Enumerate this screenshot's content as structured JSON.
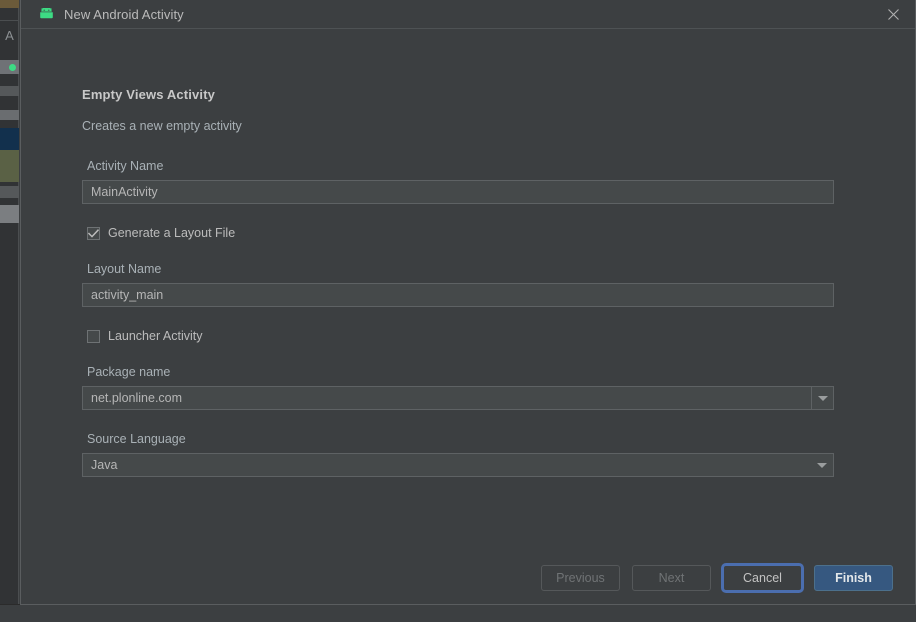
{
  "window": {
    "title": "New Android Activity",
    "app_icon": "android-robot-icon",
    "close_icon": "close-icon"
  },
  "content": {
    "template_title": "Empty Views Activity",
    "template_description": "Creates a new empty activity",
    "fields": {
      "activity_name": {
        "label": "Activity Name",
        "value": "MainActivity"
      },
      "generate_layout": {
        "label": "Generate a Layout File",
        "checked": true
      },
      "layout_name": {
        "label": "Layout Name",
        "value": "activity_main"
      },
      "launcher_activity": {
        "label": "Launcher Activity",
        "checked": false
      },
      "package_name": {
        "label": "Package name",
        "value": "net.plonline.com"
      },
      "source_language": {
        "label": "Source Language",
        "value": "Java"
      }
    }
  },
  "footer": {
    "previous_label": "Previous",
    "next_label": "Next",
    "cancel_label": "Cancel",
    "finish_label": "Finish"
  },
  "colors": {
    "dialog_bg": "#3c3f41",
    "input_bg": "#45494a",
    "text": "#bbbbbb",
    "primary_button": "#365880",
    "focus_ring": "#4b6eaf",
    "android_green": "#3ddc84"
  }
}
